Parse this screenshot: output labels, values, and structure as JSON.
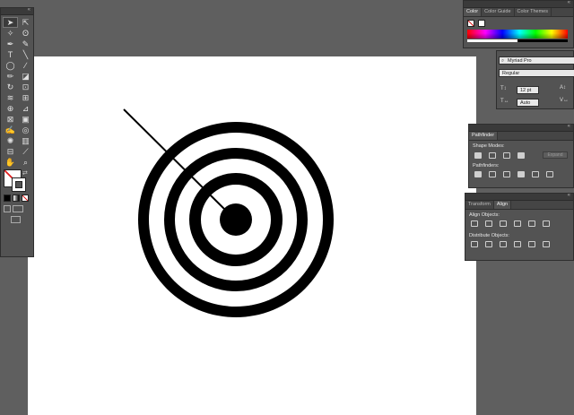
{
  "toolbox": {
    "collapse_icon": "double-chevron-left-icon",
    "tools": [
      {
        "name": "selection-tool",
        "glyph": "➤"
      },
      {
        "name": "direct-selection-tool",
        "glyph": "⇱"
      },
      {
        "name": "magic-wand-tool",
        "glyph": "✧"
      },
      {
        "name": "lasso-tool",
        "glyph": "ʘ"
      },
      {
        "name": "pen-tool",
        "glyph": "✒"
      },
      {
        "name": "curvature-tool",
        "glyph": "✎"
      },
      {
        "name": "type-tool",
        "glyph": "T"
      },
      {
        "name": "line-segment-tool",
        "glyph": "╲"
      },
      {
        "name": "ellipse-tool",
        "glyph": "◯"
      },
      {
        "name": "paintbrush-tool",
        "glyph": "∕"
      },
      {
        "name": "pencil-tool",
        "glyph": "✏"
      },
      {
        "name": "eraser-tool",
        "glyph": "◪"
      },
      {
        "name": "rotate-tool",
        "glyph": "↻"
      },
      {
        "name": "scale-tool",
        "glyph": "⊡"
      },
      {
        "name": "warp-tool",
        "glyph": "≋"
      },
      {
        "name": "free-transform-tool",
        "glyph": "⊞"
      },
      {
        "name": "shape-builder-tool",
        "glyph": "⊕"
      },
      {
        "name": "perspective-grid-tool",
        "glyph": "⊿"
      },
      {
        "name": "mesh-tool",
        "glyph": "⊠"
      },
      {
        "name": "gradient-tool",
        "glyph": "▣"
      },
      {
        "name": "eyedropper-tool",
        "glyph": "✍"
      },
      {
        "name": "blend-tool",
        "glyph": "◎"
      },
      {
        "name": "symbol-sprayer-tool",
        "glyph": "✺"
      },
      {
        "name": "column-graph-tool",
        "glyph": "▥"
      },
      {
        "name": "artboard-tool",
        "glyph": "⊟"
      },
      {
        "name": "slice-tool",
        "glyph": "⟋"
      },
      {
        "name": "hand-tool",
        "glyph": "✋"
      },
      {
        "name": "zoom-tool",
        "glyph": "⌕"
      }
    ]
  },
  "color_panel": {
    "tabs": [
      "Color",
      "Color Guide",
      "Color Themes"
    ],
    "active_tab": "Color"
  },
  "character_panel": {
    "font_family": "Myriad Pro",
    "font_style": "Regular",
    "font_size": "12 pt",
    "leading": "Auto"
  },
  "pathfinder_panel": {
    "title": "Pathfinder",
    "shape_modes_label": "Shape Modes:",
    "pathfinders_label": "Pathfinders:",
    "expand_label": "Expand"
  },
  "align_panel": {
    "tabs": [
      "Transform",
      "Align"
    ],
    "active_tab": "Align",
    "align_objects_label": "Align Objects:",
    "distribute_objects_label": "Distribute Objects:"
  },
  "colors": {
    "ui_dark": "#535353",
    "canvas_bg": "#5f5f5f",
    "artboard": "#ffffff",
    "target_black": "#000000"
  }
}
